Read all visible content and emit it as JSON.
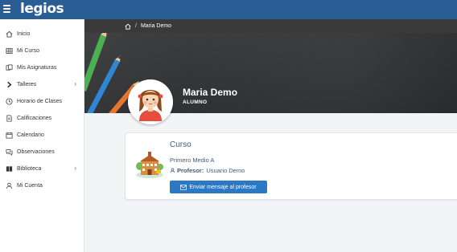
{
  "app": {
    "logo": "legios"
  },
  "sidebar": {
    "items": [
      {
        "label": "Inicio",
        "icon": "home-icon"
      },
      {
        "label": "Mi Curso",
        "icon": "table-icon"
      },
      {
        "label": "Mis Asignaturas",
        "icon": "books-icon"
      },
      {
        "label": "Talleres",
        "icon": "chevron-right-icon",
        "expandable": true
      },
      {
        "label": "Horario de Clases",
        "icon": "clock-icon"
      },
      {
        "label": "Calificaciones",
        "icon": "document-icon"
      },
      {
        "label": "Calendario",
        "icon": "calendar-icon"
      },
      {
        "label": "Observaciones",
        "icon": "comments-icon"
      },
      {
        "label": "Biblioteca",
        "icon": "book-icon",
        "expandable": true
      },
      {
        "label": "Mi Cuenta",
        "icon": "user-icon"
      }
    ]
  },
  "breadcrumb": {
    "current": "Maria Demo"
  },
  "profile": {
    "name": "Maria Demo",
    "role": "ALUMNO"
  },
  "course_card": {
    "title": "Curso",
    "grade": "Primero Medio A",
    "teacher_label": "Profesor:",
    "teacher_name": "Usuario Demo",
    "button_label": "Enviar mensaje al profesor"
  },
  "colors": {
    "topbar": "#2a5d94",
    "button": "#2b78c5",
    "text_accent": "#445a7a"
  }
}
